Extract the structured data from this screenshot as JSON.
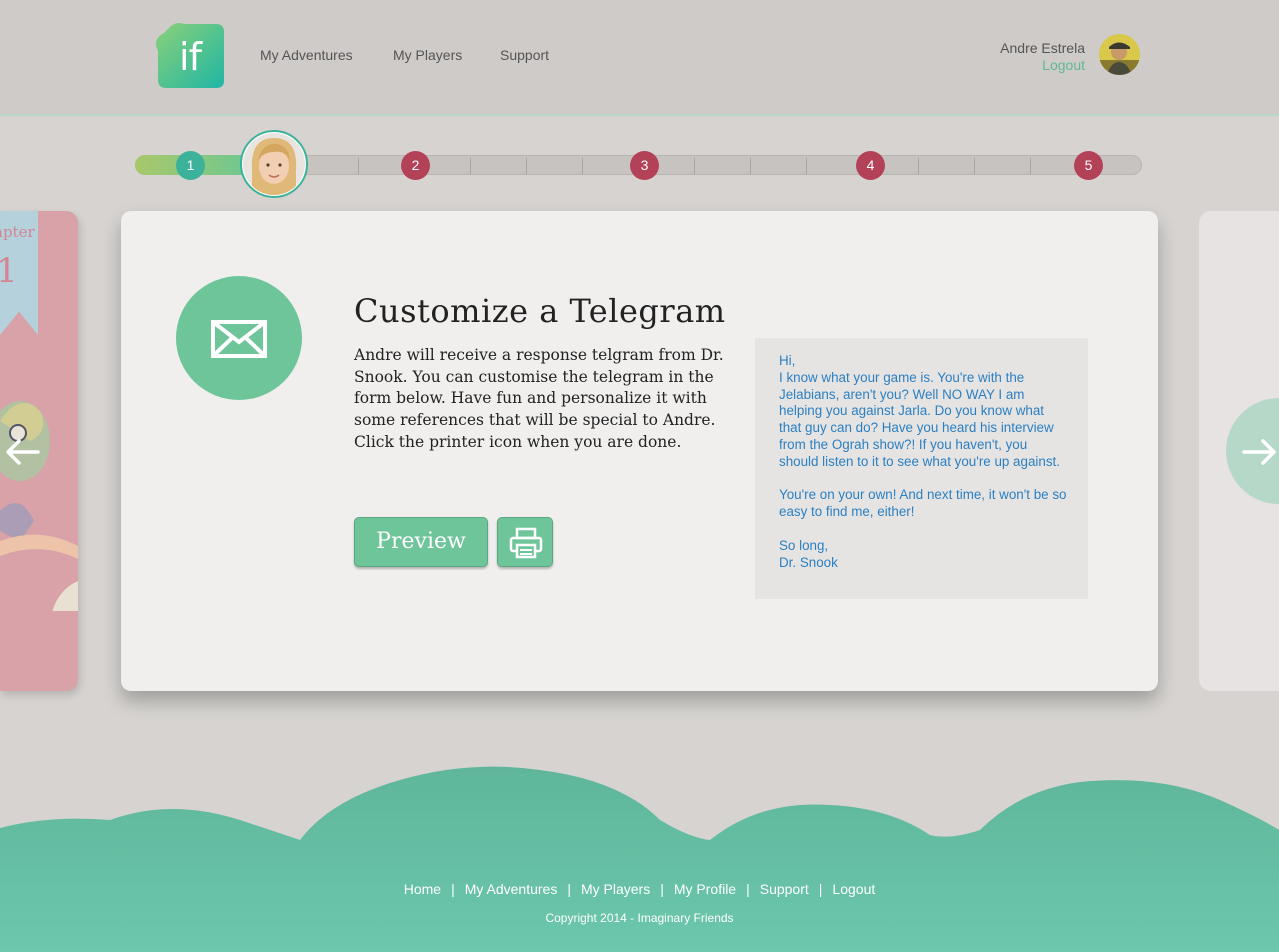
{
  "header": {
    "logo_text": "if",
    "nav": [
      {
        "label": "My Adventures"
      },
      {
        "label": "My Players"
      },
      {
        "label": "Support"
      }
    ],
    "user": {
      "name": "Andre Estrela",
      "logout": "Logout"
    }
  },
  "progress": {
    "steps": [
      "1",
      "2",
      "3",
      "4",
      "5"
    ],
    "current_step": 1
  },
  "left_card": {
    "label": "apter",
    "number": "1"
  },
  "main": {
    "title": "Customize a Telegram",
    "description": "Andre will receive a response telgram from Dr. Snook. You can customise the telegram in the form below. Have fun and personalize it with some references that will be special to Andre. Click the printer icon when you are done.",
    "preview_label": "Preview",
    "telegram": [
      "Hi,\nI know what your game is. You're with the Jelabians, aren't you? Well NO WAY I am helping you against Jarla. Do you know what that guy can do? Have you heard his interview from the Ograh show?! If you haven't, you should listen to it to see what you're up against.",
      "You're on your own! And next time, it won't be so easy to find me, either!",
      "So long,\nDr. Snook"
    ]
  },
  "footer": {
    "links": [
      "Home",
      "My Adventures",
      "My Players",
      "My Profile",
      "Support",
      "Logout"
    ],
    "separator": "|",
    "copyright": "Copyright 2014 - Imaginary Friends"
  },
  "colors": {
    "accent_green": "#6fc59a",
    "step_done": "#3bb299",
    "step_todo": "#b34158",
    "telegram_text": "#2c7fc2",
    "footer_teal": "#6cc4ab"
  }
}
